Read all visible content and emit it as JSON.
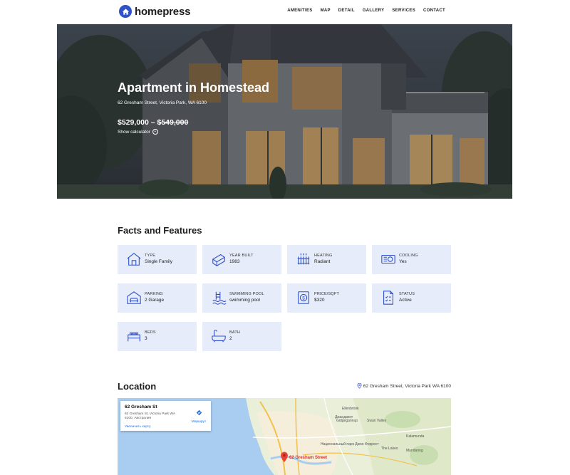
{
  "header": {
    "brand": "homepress",
    "nav": [
      "AMENITIES",
      "MAP",
      "DETAIL",
      "GALLERY",
      "SERVICES",
      "CONTACT"
    ]
  },
  "hero": {
    "title": "Apartment in Homestead",
    "address": "62 Gresham Street, Victoria Park, WA 6100",
    "price_low": "$529,000",
    "price_sep": "–",
    "price_high": "$549,000",
    "calculator_label": "Show calculator"
  },
  "facts": {
    "title": "Facts and Features",
    "items": [
      {
        "label": "TYPE",
        "value": "Single Family",
        "icon": "house-icon"
      },
      {
        "label": "YEAR BUILT",
        "value": "1983",
        "icon": "calendar-icon"
      },
      {
        "label": "HEATING",
        "value": "Radiant",
        "icon": "radiator-icon"
      },
      {
        "label": "COOLING",
        "value": "Yes",
        "icon": "air-conditioner-icon"
      },
      {
        "label": "PARKING",
        "value": "2 Garage",
        "icon": "garage-icon"
      },
      {
        "label": "SWIMMING POOL",
        "value": "swimming pool",
        "icon": "pool-icon"
      },
      {
        "label": "PRICE/SQFT",
        "value": "$320",
        "icon": "price-tag-icon"
      },
      {
        "label": "STATUS",
        "value": "Active",
        "icon": "checklist-icon"
      },
      {
        "label": "BEDS",
        "value": "3",
        "icon": "bed-icon"
      },
      {
        "label": "BATH",
        "value": "2",
        "icon": "bathtub-icon"
      }
    ]
  },
  "location": {
    "title": "Location",
    "address": "62 Gresham Street, Victoria Park WA 6100",
    "map": {
      "card_title": "62 Gresham St",
      "card_address": "62 Gresham St, Victoria Park WA 6100, Австралия",
      "route_label": "Маршрут",
      "enlarge_label": "Увеличить карту",
      "pin_label": "62 Gresham Street",
      "places": [
        "Джандакот",
        "Gidgegannup",
        "Ellenbrook",
        "Swan Valley",
        "Kalamunda",
        "The Lakes",
        "Mundaring",
        "Национальный парк Джон Форрест"
      ]
    }
  },
  "colors": {
    "accent": "#2f52c9",
    "card_bg": "#e7ecfa",
    "map_water": "#a9cdf0",
    "map_land": "#e9efd9"
  }
}
